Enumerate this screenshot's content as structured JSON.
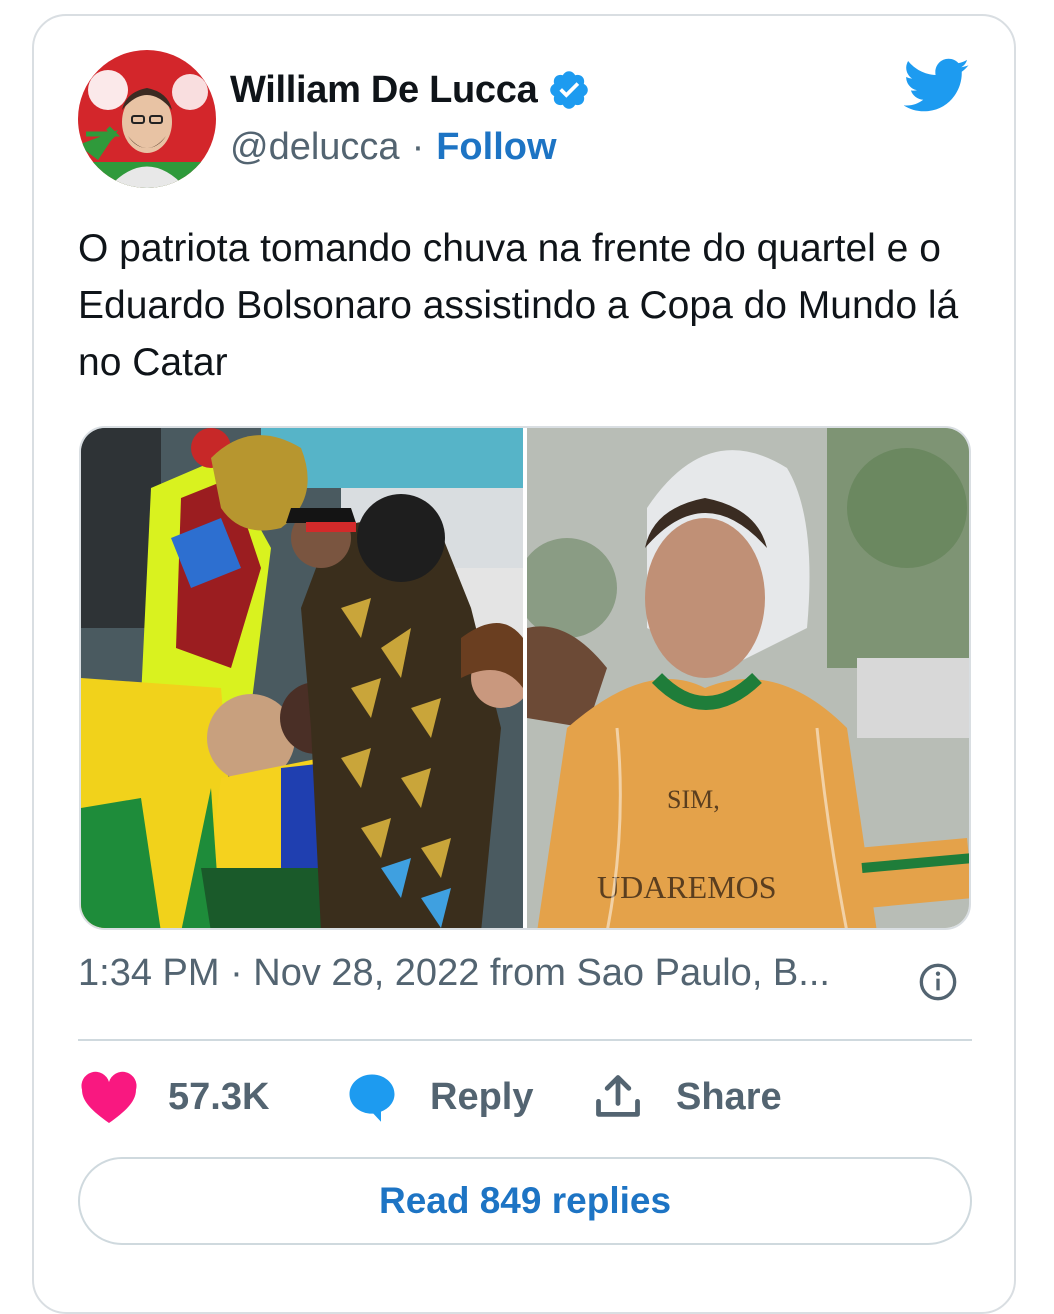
{
  "author": {
    "name": "William De Lucca",
    "handle": "@delucca",
    "separator": "·",
    "follow_label": "Follow",
    "verified": true
  },
  "tweet": {
    "text": "O patriota tomando chuva na frente do quartel e o Eduardo Bolsonaro assistindo a Copa do Mundo lá no Catar",
    "timestamp": "1:34 PM · Nov 28, 2022 from Sao Paulo, B..."
  },
  "media": [
    {
      "name": "stadium-celebration-photo"
    },
    {
      "name": "rain-poncho-man-photo",
      "shirt_text_top": "SIM,",
      "shirt_text_bottom": "UDAREMOS"
    }
  ],
  "actions": {
    "likes_count": "57.3K",
    "reply_label": "Reply",
    "share_label": "Share"
  },
  "read_replies_label": "Read 849 replies",
  "colors": {
    "accent": "#1d74c4",
    "twitter_blue": "#1d9bf0",
    "heart": "#f91880",
    "muted": "#536471"
  },
  "icons": [
    "twitter-bird-icon",
    "verified-badge-icon",
    "info-icon",
    "heart-icon",
    "reply-bubble-icon",
    "share-icon"
  ]
}
